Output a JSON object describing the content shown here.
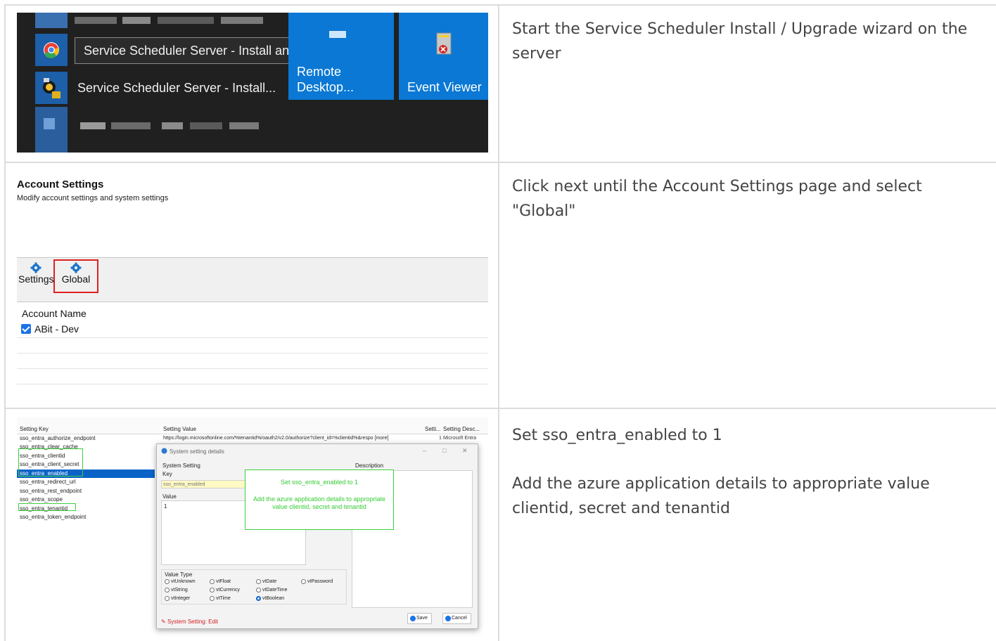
{
  "rows": [
    {
      "description": [
        "Start the Service Scheduler Install / Upgrade wizard on the server"
      ],
      "screenshot": {
        "tooltip": "Service Scheduler Server - Install and Upgrade Wizard",
        "app_label": "Service Scheduler Server - Install...",
        "tiles": [
          {
            "line1": "Remote",
            "line2": "Desktop..."
          },
          {
            "label": "Event Viewer"
          }
        ]
      }
    },
    {
      "description": [
        "Click next until the Account Settings page and select \"Global\""
      ],
      "screenshot": {
        "title": "Account Settings",
        "subtitle": "Modify account settings and system settings",
        "toolbar": [
          "Settings",
          "Global"
        ],
        "column_header": "Account Name",
        "accounts": [
          "ABit - Dev"
        ]
      }
    },
    {
      "description": [
        "Set sso_entra_enabled to 1",
        "Add the azure application details to appropriate value clientid, secret and tenantid"
      ],
      "screenshot": {
        "columns": [
          "Setting Key",
          "Setting Value",
          "Setti...",
          "Setting Desc..."
        ],
        "keys": [
          "sso_entra_authorize_endpoint",
          "sso_entra_clear_cache",
          "sso_entra_clientid",
          "sso_entra_client_secret",
          "sso_entra_enabled",
          "sso_entra_redirect_url",
          "sso_entra_rest_endpoint",
          "sso_entra_scope",
          "sso_entra_tenantid",
          "sso_entra_token_endpoint"
        ],
        "first_value": "https://login.microsoftonline.com/%tenantid%/oauth2/v2.0/authorize?client_id=%clientid%&respo [more]",
        "first_num": "1",
        "first_desc": "Microsoft Entra",
        "dialog": {
          "title": "System setting details",
          "section": "System Setting",
          "key_label": "Key",
          "key_value": "sso_entra_enabled",
          "value_label": "Value",
          "value": "1",
          "description_label": "Description",
          "value_type_label": "Value Type",
          "value_types": [
            "vtUnknown",
            "vtFloat",
            "vtDate",
            "vtPassword",
            "vtString",
            "vtCurrency",
            "vtDateTime",
            "vtInteger",
            "vtTime",
            "vtBoolean"
          ],
          "selected_type": "vtBoolean",
          "status": "System Setting: Edit",
          "save": "Save",
          "cancel": "Cancel"
        },
        "callout": {
          "line1": "Set sso_entra_enabled to 1",
          "line2": "Add the azure application details to appropriate value clientid, secret and tenantid"
        }
      }
    }
  ],
  "colors": {
    "tile_blue": "#0a78d4",
    "highlight_red": "#e02020",
    "highlight_green": "#3ccf3c",
    "selection_blue": "#0a64c8"
  }
}
